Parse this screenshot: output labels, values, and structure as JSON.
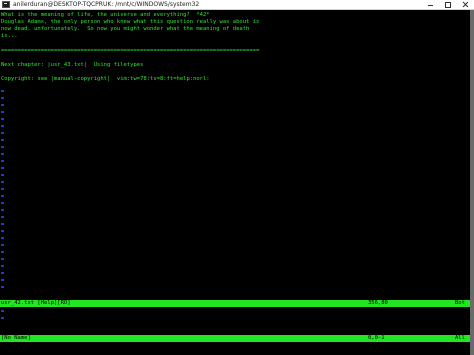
{
  "window": {
    "title": "anilerduran@DESKTOP-TQCPRUK: /mnt/c/WINDOWS/system32"
  },
  "buffer": {
    "lines": [
      "What is the meaning of life, the universe and everything?  *42*",
      "Douglas Adams, the only person who knew what this question really was about is",
      "now dead, unfortunately.  So now you might wonder what the meaning of death",
      "is..."
    ],
    "separator": "==============================================================================",
    "next_chapter": {
      "label": "Next chapter: ",
      "link": "usr_43.txt",
      "text": "  Using filetypes"
    },
    "copyright": {
      "label": "Copyright: see ",
      "link": "manual-copyright",
      "modeline": "  vim:tw=78:ts=8:ft=help:norl:"
    },
    "tilde_count": 29
  },
  "status_help": {
    "filename": "usr_42.txt [Help][RO]",
    "position": "356,80",
    "scroll": "Bot"
  },
  "status_noname": {
    "filename": "[No Name]",
    "position": "0,0-1",
    "scroll": "All"
  },
  "colors": {
    "text": "#2ee62e",
    "statusline": "#22e622",
    "tilde": "#1a3ec8",
    "background": "#000000"
  }
}
